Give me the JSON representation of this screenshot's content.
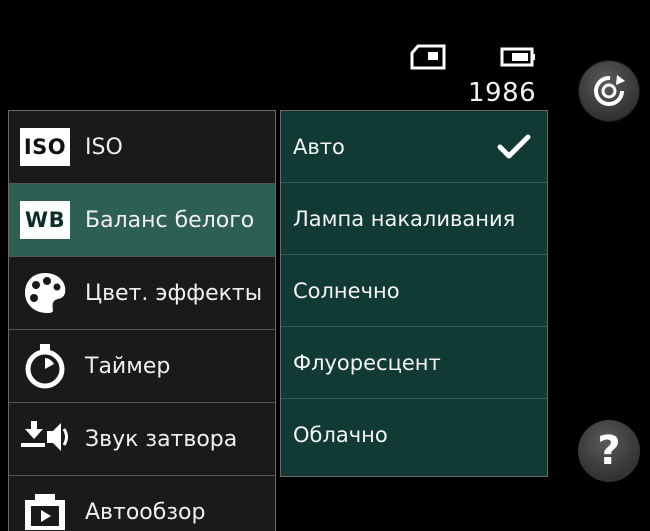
{
  "status": {
    "shots_remaining": "1986",
    "storage_icon": "sd-card-icon",
    "battery_icon": "battery-icon"
  },
  "buttons": {
    "rotate_icon": "rotate-camera-icon",
    "help_label": "?"
  },
  "menu": {
    "items": [
      {
        "label": "ISO",
        "icon_text": "ISO",
        "icon": "iso-icon",
        "selected": false
      },
      {
        "label": "Баланс белого",
        "icon_text": "WB",
        "icon": "white-balance-icon",
        "selected": true
      },
      {
        "label": "Цвет. эффекты",
        "icon": "palette-icon",
        "selected": false
      },
      {
        "label": "Таймер",
        "icon": "timer-icon",
        "selected": false
      },
      {
        "label": "Звук затвора",
        "icon": "shutter-sound-icon",
        "selected": false
      },
      {
        "label": "Автообзор",
        "icon": "auto-review-icon",
        "selected": false
      }
    ]
  },
  "options": {
    "items": [
      {
        "label": "Авто",
        "checked": true
      },
      {
        "label": "Лампа накаливания",
        "checked": false
      },
      {
        "label": "Солнечно",
        "checked": false
      },
      {
        "label": "Флуоресцент",
        "checked": false
      },
      {
        "label": "Облачно",
        "checked": false
      }
    ]
  },
  "colors": {
    "selected_row": "#2d5f55",
    "options_bg": "#113a34"
  }
}
